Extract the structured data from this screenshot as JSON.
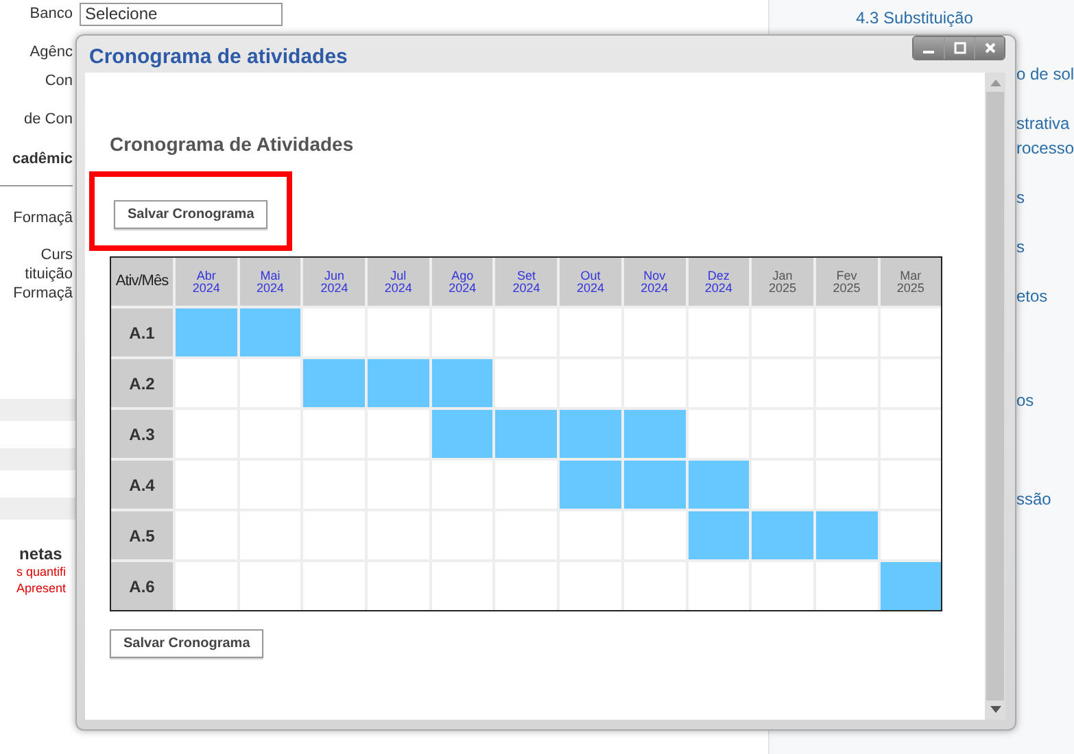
{
  "background_page": {
    "left_labels": [
      {
        "text": "Banco",
        "bold": false
      },
      {
        "text": "Agênc",
        "bold": false
      },
      {
        "text": "Con",
        "bold": false
      },
      {
        "text": "de Con",
        "bold": false
      },
      {
        "text": "cadêmic",
        "bold": true
      },
      {
        "text": "Formaçã",
        "bold": false
      },
      {
        "text": "Curs",
        "bold": false
      },
      {
        "text": "tituição",
        "bold": false
      },
      {
        "text": "Formaçã",
        "bold": false
      }
    ],
    "bank_select": {
      "value": "Selecione"
    },
    "section_title": "netas",
    "warnings": [
      "s quantifi",
      "Apresent"
    ],
    "right_links": [
      "4.3 Substituição",
      "o de sol",
      "strativa",
      "rocesso",
      "s",
      "s",
      "etos",
      "os",
      "ssão"
    ]
  },
  "dialog": {
    "title": "Cronograma de atividades",
    "heading": "Cronograma de Atividades",
    "buttons": [
      {
        "label": "Salvar Cronograma",
        "highlighted": true
      },
      {
        "label": "Salvar Cronograma",
        "highlighted": false
      }
    ],
    "table": {
      "corner": "Ativ/Mês",
      "columns": [
        {
          "month": "Abr",
          "year": "2024",
          "linked": true
        },
        {
          "month": "Mai",
          "year": "2024",
          "linked": true
        },
        {
          "month": "Jun",
          "year": "2024",
          "linked": true
        },
        {
          "month": "Jul",
          "year": "2024",
          "linked": true
        },
        {
          "month": "Ago",
          "year": "2024",
          "linked": true
        },
        {
          "month": "Set",
          "year": "2024",
          "linked": true
        },
        {
          "month": "Out",
          "year": "2024",
          "linked": true
        },
        {
          "month": "Nov",
          "year": "2024",
          "linked": true
        },
        {
          "month": "Dez",
          "year": "2024",
          "linked": true
        },
        {
          "month": "Jan",
          "year": "2025",
          "linked": false
        },
        {
          "month": "Fev",
          "year": "2025",
          "linked": false
        },
        {
          "month": "Mar",
          "year": "2025",
          "linked": false
        }
      ],
      "rows": [
        {
          "label": "A.1",
          "cells": [
            true,
            true,
            false,
            false,
            false,
            false,
            false,
            false,
            false,
            false,
            false,
            false
          ]
        },
        {
          "label": "A.2",
          "cells": [
            false,
            false,
            true,
            true,
            true,
            false,
            false,
            false,
            false,
            false,
            false,
            false
          ]
        },
        {
          "label": "A.3",
          "cells": [
            false,
            false,
            false,
            false,
            true,
            true,
            true,
            true,
            false,
            false,
            false,
            false
          ]
        },
        {
          "label": "A.4",
          "cells": [
            false,
            false,
            false,
            false,
            false,
            false,
            true,
            true,
            true,
            false,
            false,
            false
          ]
        },
        {
          "label": "A.5",
          "cells": [
            false,
            false,
            false,
            false,
            false,
            false,
            false,
            false,
            true,
            true,
            true,
            false
          ]
        },
        {
          "label": "A.6",
          "cells": [
            false,
            false,
            false,
            false,
            false,
            false,
            false,
            false,
            false,
            false,
            false,
            true
          ]
        }
      ]
    }
  }
}
